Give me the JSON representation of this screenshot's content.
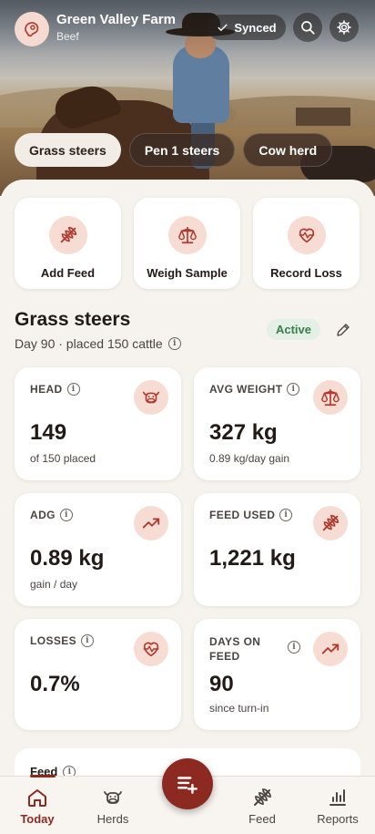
{
  "header": {
    "farm_name": "Green Valley Farm",
    "farm_type": "Beef",
    "sync_status": "Synced",
    "icons": {
      "logo": "steak-icon",
      "search": "search-icon",
      "settings": "gear-icon"
    }
  },
  "herd_tabs": [
    {
      "label": "Grass steers",
      "active": true
    },
    {
      "label": "Pen 1 steers",
      "active": false
    },
    {
      "label": "Cow herd",
      "active": false
    }
  ],
  "quick_actions": [
    {
      "label": "Add Feed",
      "icon": "wheat-icon"
    },
    {
      "label": "Weigh Sample",
      "icon": "scale-icon"
    },
    {
      "label": "Record Loss",
      "icon": "heart-pulse-icon"
    }
  ],
  "group": {
    "title": "Grass steers",
    "subtitle": "Day 90 · placed 150 cattle",
    "status": "Active"
  },
  "stats": [
    {
      "label": "HEAD",
      "value": "149",
      "note": "of 150 placed",
      "icon": "cow-icon"
    },
    {
      "label": "AVG WEIGHT",
      "value": "327 kg",
      "note": "0.89 kg/day gain",
      "icon": "scale-icon"
    },
    {
      "label": "ADG",
      "value": "0.89 kg",
      "note": "gain / day",
      "icon": "trending-up-icon"
    },
    {
      "label": "FEED USED",
      "value": "1,221 kg",
      "note": "",
      "icon": "wheat-icon"
    },
    {
      "label": "LOSSES",
      "value": "0.7%",
      "note": "",
      "icon": "heart-pulse-icon"
    },
    {
      "label": "DAYS ON FEED",
      "value": "90",
      "note": "since turn-in",
      "icon": "trending-up-icon"
    }
  ],
  "feed_section": {
    "title": "Feed"
  },
  "bottom_nav": [
    {
      "label": "Today",
      "icon": "home-icon",
      "active": true
    },
    {
      "label": "Herds",
      "icon": "cow-icon",
      "active": false
    },
    {
      "label": "Feed",
      "icon": "wheat-icon",
      "active": false
    },
    {
      "label": "Reports",
      "icon": "bar-chart-icon",
      "active": false
    }
  ],
  "colors": {
    "accent": "#8c2a22",
    "icon_bg": "#f7dcd3",
    "background": "#f6f2ed",
    "active_badge_bg": "#e4efe6",
    "active_badge_text": "#3b7c4d"
  }
}
